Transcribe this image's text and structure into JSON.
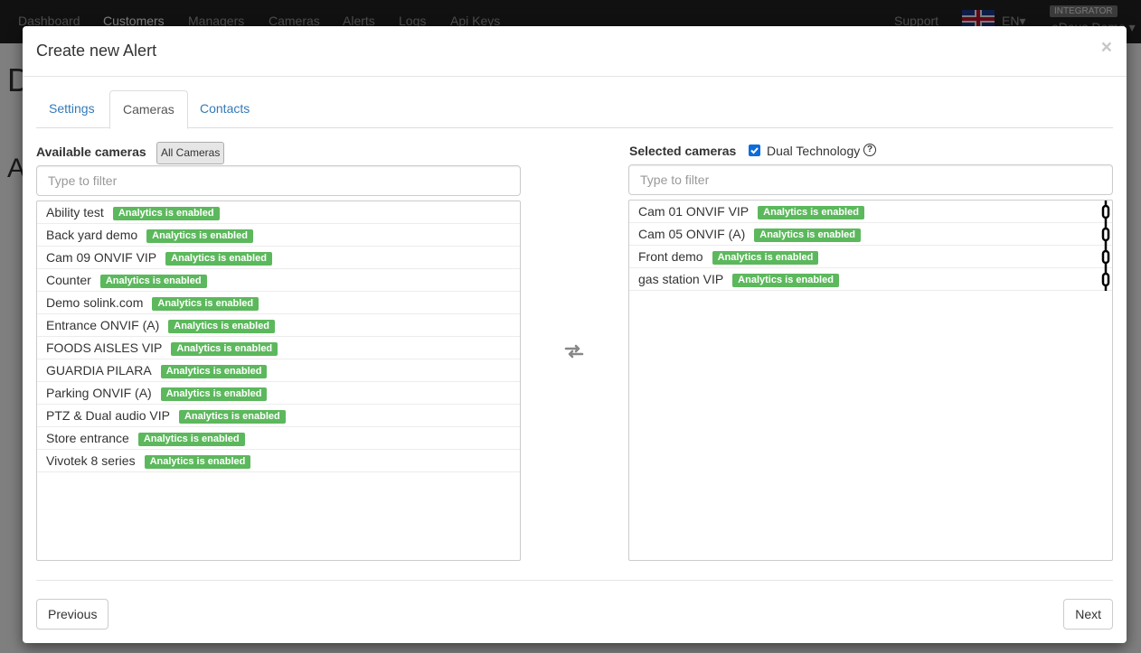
{
  "navbar": {
    "items": [
      "Dashboard",
      "Customers",
      "Managers",
      "Cameras",
      "Alerts",
      "Logs",
      "Api Keys"
    ],
    "support": "Support",
    "language": "EN",
    "role_badge": "INTEGRATOR",
    "user": "eDeus Demo"
  },
  "background": {
    "heading_letter": "D",
    "subheading_letter": "A"
  },
  "modal": {
    "title": "Create new Alert",
    "close_label": "×",
    "tabs": [
      "Settings",
      "Cameras",
      "Contacts"
    ],
    "active_tab": "Cameras"
  },
  "available": {
    "label": "Available cameras",
    "all_button": "All Cameras",
    "filter_placeholder": "Type to filter",
    "cameras": [
      {
        "name": "Ability test",
        "badge": "Analytics is enabled"
      },
      {
        "name": "Back yard demo",
        "badge": "Analytics is enabled"
      },
      {
        "name": "Cam 09 ONVIF VIP",
        "badge": "Analytics is enabled"
      },
      {
        "name": "Counter",
        "badge": "Analytics is enabled"
      },
      {
        "name": "Demo solink.com",
        "badge": "Analytics is enabled"
      },
      {
        "name": "Entrance ONVIF (A)",
        "badge": "Analytics is enabled"
      },
      {
        "name": "FOODS AISLES VIP",
        "badge": "Analytics is enabled"
      },
      {
        "name": "GUARDIA PILARA",
        "badge": "Analytics is enabled"
      },
      {
        "name": "Parking ONVIF (A)",
        "badge": "Analytics is enabled"
      },
      {
        "name": "PTZ & Dual audio VIP",
        "badge": "Analytics is enabled"
      },
      {
        "name": "Store entrance",
        "badge": "Analytics is enabled"
      },
      {
        "name": "Vivotek 8 series",
        "badge": "Analytics is enabled"
      }
    ]
  },
  "selected": {
    "label": "Selected cameras",
    "dual_technology_label": "Dual Technology",
    "dual_technology_checked": true,
    "help_icon_glyph": "?",
    "filter_placeholder": "Type to filter",
    "cameras": [
      {
        "name": "Cam 01 ONVIF VIP",
        "badge": "Analytics is enabled"
      },
      {
        "name": "Cam 05 ONVIF (A)",
        "badge": "Analytics is enabled"
      },
      {
        "name": "Front demo",
        "badge": "Analytics is enabled"
      },
      {
        "name": "gas station VIP",
        "badge": "Analytics is enabled"
      }
    ]
  },
  "footer": {
    "previous": "Previous",
    "next": "Next"
  },
  "colors": {
    "badge_green": "#5cb85c",
    "link_blue": "#337ab7",
    "checkbox_blue": "#0b6cdb",
    "navbar_bg": "#222222"
  }
}
